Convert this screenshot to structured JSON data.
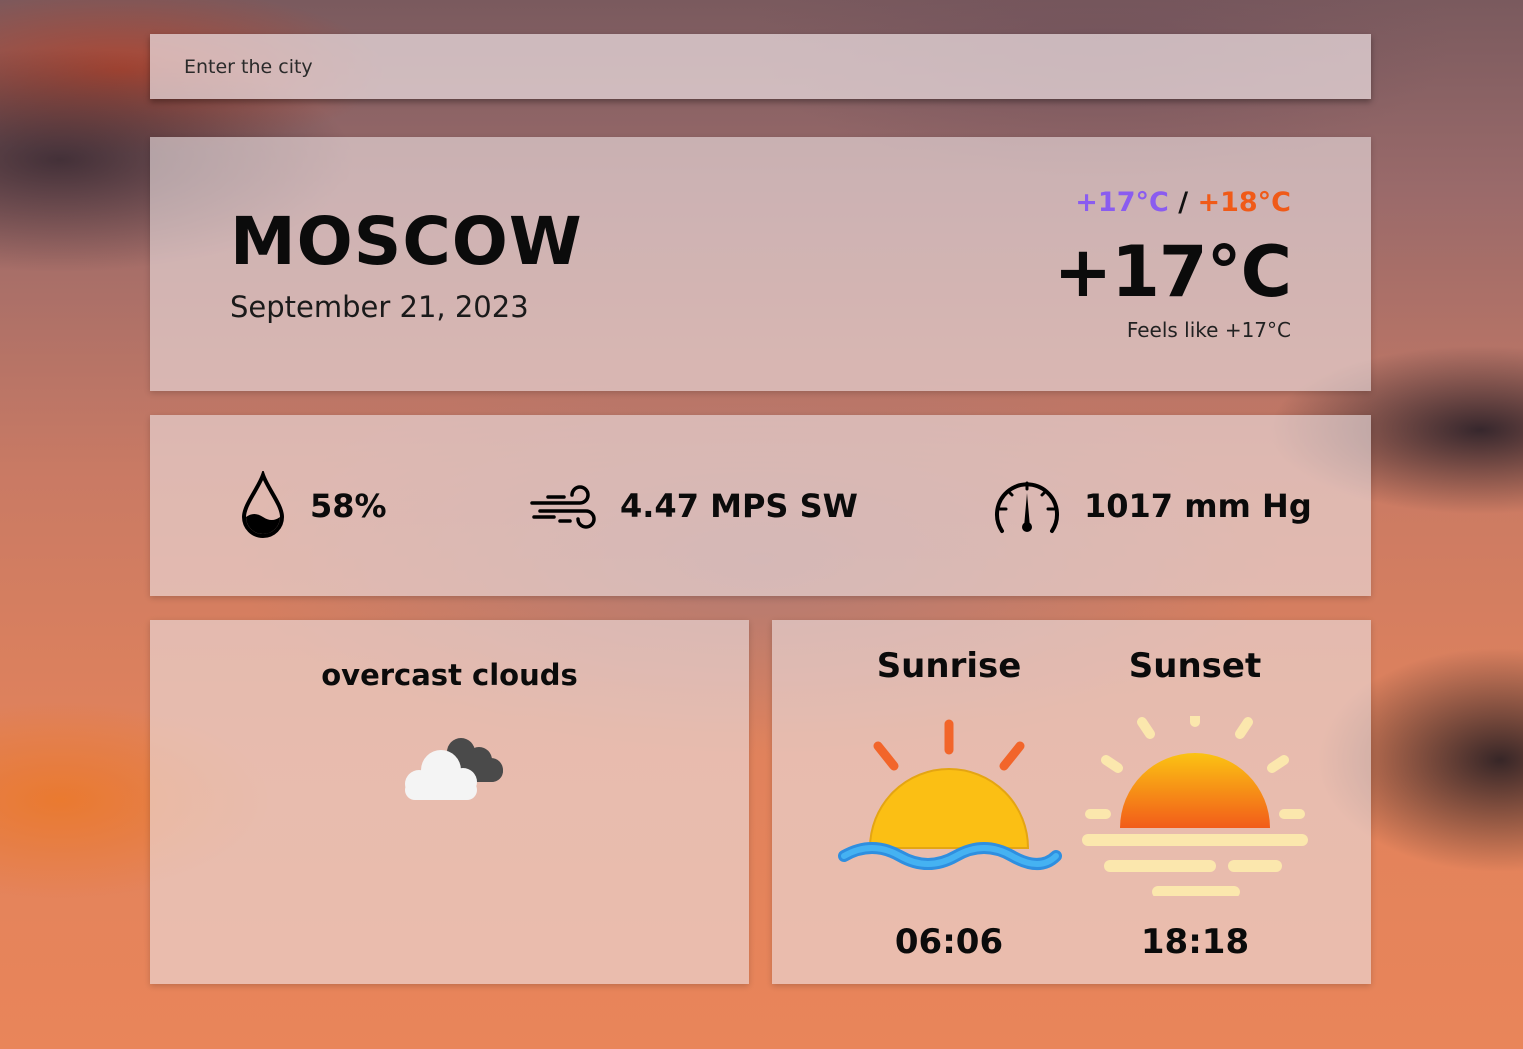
{
  "search": {
    "placeholder": "Enter the city"
  },
  "weather": {
    "city": "MOSCOW",
    "date": "September 21, 2023",
    "temp_min": "+17°C",
    "temp_separator": "/",
    "temp_max": "+18°C",
    "temp_now": "+17°C",
    "feels_like_prefix": "Feels like",
    "feels_like_value": "+17°C"
  },
  "stats": {
    "humidity": "58%",
    "wind": "4.47 MPS SW",
    "pressure": "1017 mm Hg"
  },
  "description": {
    "text": "overcast clouds",
    "icon": "overcast-clouds-icon"
  },
  "sun": {
    "sunrise_label": "Sunrise",
    "sunrise_time": "06:06",
    "sunset_label": "Sunset",
    "sunset_time": "18:18"
  },
  "colors": {
    "temp_min": "#8a5cf0",
    "temp_max": "#f05a18",
    "sun_yellow": "#fbbf14",
    "sun_orange": "#f25c1a",
    "water_blue": "#3aa0e8"
  }
}
